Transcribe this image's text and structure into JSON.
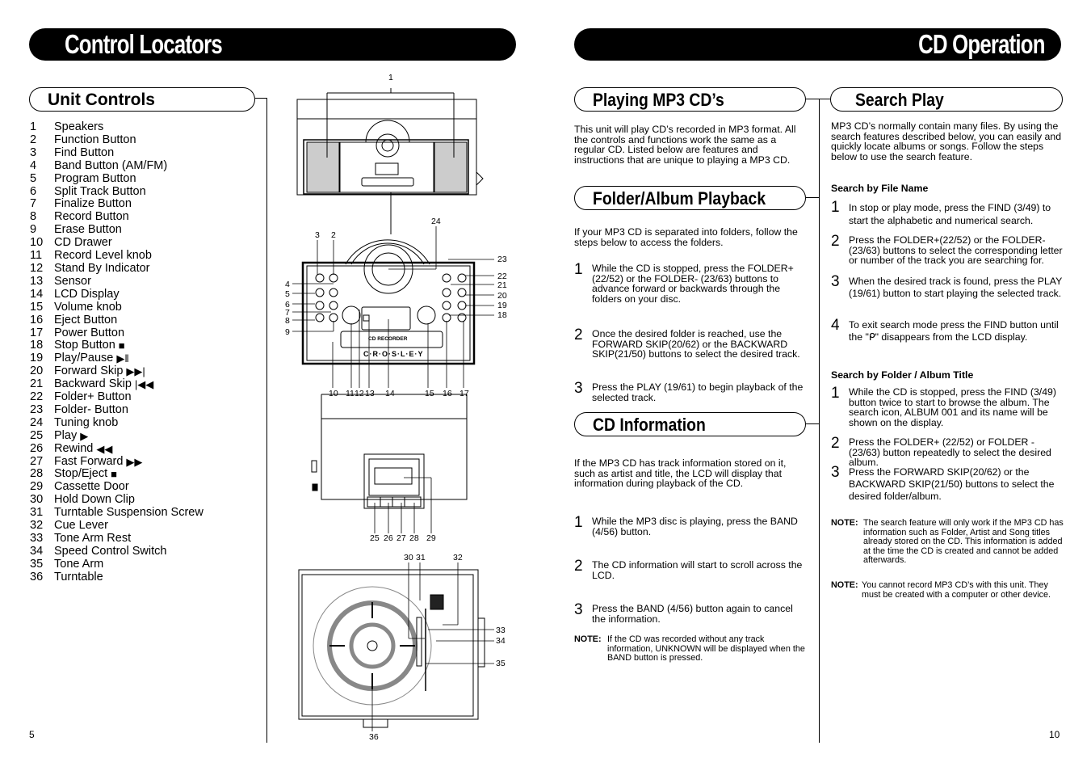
{
  "left_page": {
    "banner_title": "Control Locators",
    "section_title": "Unit Controls",
    "controls": [
      {
        "num": "1",
        "label": "Speakers",
        "symbol": ""
      },
      {
        "num": "2",
        "label": "Function Button",
        "symbol": ""
      },
      {
        "num": "3",
        "label": "Find Button",
        "symbol": ""
      },
      {
        "num": "4",
        "label": "Band Button (AM/FM)",
        "symbol": ""
      },
      {
        "num": "5",
        "label": "Program Button",
        "symbol": ""
      },
      {
        "num": "6",
        "label": "Split Track Button",
        "symbol": ""
      },
      {
        "num": "7",
        "label": "Finalize Button",
        "symbol": ""
      },
      {
        "num": "8",
        "label": "Record Button",
        "symbol": ""
      },
      {
        "num": "9",
        "label": "Erase Button",
        "symbol": ""
      },
      {
        "num": "10",
        "label": "CD Drawer",
        "symbol": ""
      },
      {
        "num": "11",
        "label": "Record Level knob",
        "symbol": ""
      },
      {
        "num": "12",
        "label": "Stand By Indicator",
        "symbol": ""
      },
      {
        "num": "13",
        "label": "Sensor",
        "symbol": ""
      },
      {
        "num": "14",
        "label": "LCD Display",
        "symbol": ""
      },
      {
        "num": "15",
        "label": "Volume knob",
        "symbol": ""
      },
      {
        "num": "16",
        "label": "Eject Button",
        "symbol": ""
      },
      {
        "num": "17",
        "label": "Power Button",
        "symbol": ""
      },
      {
        "num": "18",
        "label": "Stop Button",
        "symbol": "■"
      },
      {
        "num": "19",
        "label": "Play/Pause",
        "symbol": "▶‖"
      },
      {
        "num": "20",
        "label": "Forward Skip",
        "symbol": "▶▶|"
      },
      {
        "num": "21",
        "label": "Backward Skip",
        "symbol": "|◀◀"
      },
      {
        "num": "22",
        "label": "Folder+ Button",
        "symbol": ""
      },
      {
        "num": "23",
        "label": "Folder- Button",
        "symbol": ""
      },
      {
        "num": "24",
        "label": "Tuning knob",
        "symbol": ""
      },
      {
        "num": "25",
        "label": "Play",
        "symbol": "▶"
      },
      {
        "num": "26",
        "label": "Rewind",
        "symbol": "◀◀"
      },
      {
        "num": "27",
        "label": "Fast Forward",
        "symbol": "▶▶"
      },
      {
        "num": "28",
        "label": "Stop/Eject",
        "symbol": "■"
      },
      {
        "num": "29",
        "label": "Cassette Door",
        "symbol": ""
      },
      {
        "num": "30",
        "label": "Hold Down Clip",
        "symbol": ""
      },
      {
        "num": "31",
        "label": "Turntable Suspension Screw",
        "symbol": ""
      },
      {
        "num": "32",
        "label": "Cue Lever",
        "symbol": ""
      },
      {
        "num": "33",
        "label": "Tone Arm Rest",
        "symbol": ""
      },
      {
        "num": "34",
        "label": "Speed Control Switch",
        "symbol": ""
      },
      {
        "num": "35",
        "label": "Tone Arm",
        "symbol": ""
      },
      {
        "num": "36",
        "label": "Turntable",
        "symbol": ""
      }
    ],
    "diagram": {
      "brand": "C·R·O·S·L·E·Y",
      "drawer_label": "CD RECORDER",
      "callouts_front": [
        "1",
        "2",
        "3",
        "4",
        "5",
        "6",
        "7",
        "8",
        "9",
        "10",
        "11",
        "12",
        "13",
        "14",
        "15",
        "16",
        "17",
        "18",
        "19",
        "20",
        "21",
        "22",
        "23",
        "24"
      ],
      "callouts_side": [
        "25",
        "26",
        "27",
        "28",
        "29"
      ],
      "callouts_top": [
        "30",
        "31",
        "32",
        "33",
        "34",
        "35",
        "36"
      ]
    },
    "page_number": "5"
  },
  "right_page": {
    "banner_title": "CD Operation",
    "playing_mp3": {
      "title": "Playing MP3 CD’s",
      "intro": "This unit will play CD’s recorded in MP3 format. All the controls and functions work the same as a regular CD. Listed below are features and instructions that are unique to playing a MP3 CD."
    },
    "folder_playback": {
      "title": "Folder/Album Playback",
      "intro": "If your MP3 CD is separated into folders, follow the steps below to access the folders.",
      "steps": [
        {
          "n": "1",
          "text": "While the CD is stopped, press the FOLDER+ (22/52) or the FOLDER- (23/63) buttons to advance forward or backwards through the folders on your disc."
        },
        {
          "n": "2",
          "text": "Once the desired folder is reached, use the FORWARD SKIP(20/62) or the BACKWARD SKIP(21/50) buttons to select the desired track."
        },
        {
          "n": "3",
          "text": "Press the PLAY (19/61) to begin playback of the selected track."
        }
      ]
    },
    "cd_information": {
      "title": "CD Information",
      "intro": "If the MP3 CD has track information stored on it, such as artist and title, the LCD will display that information during playback of the CD.",
      "steps": [
        {
          "n": "1",
          "text": "While the MP3 disc is playing, press the BAND (4/56) button."
        },
        {
          "n": "2",
          "text": "The CD information will start to scroll across the LCD."
        },
        {
          "n": "3",
          "text": "Press the BAND (4/56) button again to cancel the information."
        }
      ],
      "note_label": "NOTE:",
      "note": "If the CD was recorded without any track information, UNKNOWN will be displayed when the BAND button is pressed."
    },
    "search_play": {
      "title": "Search Play",
      "intro": "MP3 CD’s normally contain many files. By using the search features described below, you can easily and quickly locate albums or songs. Follow the steps below to use the search feature.",
      "by_file_name": {
        "heading": "Search by File Name",
        "steps": [
          {
            "n": "1",
            "text": "In stop or play mode, press the FIND (3/49) to start the alphabetic and numerical search."
          },
          {
            "n": "2",
            "text": "Press the FOLDER+(22/52) or the FOLDER-(23/63) buttons to select the corresponding letter or number of the track you are searching for."
          },
          {
            "n": "3",
            "text": "When the desired track is found, press the PLAY (19/61) button to start playing the selected track."
          },
          {
            "n": "4",
            "text": "To exit search mode press the FIND button until the \"ᑭ\" disappears from the LCD display."
          }
        ]
      },
      "by_folder": {
        "heading": "Search by Folder / Album Title",
        "steps": [
          {
            "n": "1",
            "text": "While the CD is stopped, press the FIND (3/49) button twice to start to browse the album. The search icon, ALBUM 001 and its name will be shown on the display."
          },
          {
            "n": "2",
            "text": "Press the  FOLDER+ (22/52) or  FOLDER - (23/63) button repeatedly to select the desired album."
          },
          {
            "n": "3",
            "text": "Press the FORWARD SKIP(20/62) or the BACKWARD SKIP(21/50) buttons to select the desired folder/album."
          }
        ]
      },
      "notes": [
        {
          "label": "NOTE:",
          "text": "The search feature will only work if the MP3 CD has information such as Folder, Artist and Song titles already stored on the CD. This information is added at the time the CD is created and cannot be added afterwards."
        },
        {
          "label": "NOTE:",
          "text": "You cannot record MP3 CD’s with this unit. They must be created with a computer or other device."
        }
      ]
    },
    "page_number": "10"
  }
}
